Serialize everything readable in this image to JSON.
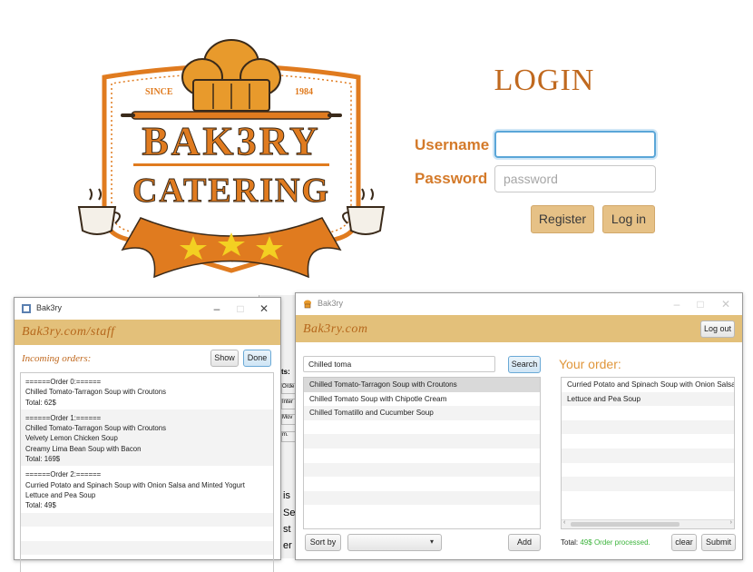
{
  "logo": {
    "since": "SINCE",
    "year": "1984",
    "word1": "BAK3RY",
    "word2": "CATERING",
    "colors": {
      "orange": "#e07b1f",
      "gold": "#f0c020",
      "dark": "#3a2a1a"
    }
  },
  "login": {
    "title": "LOGIN",
    "username_label": "Username",
    "username_value": "",
    "password_label": "Password",
    "password_placeholder": "password",
    "register_label": "Register",
    "login_label": "Log in"
  },
  "staff_window": {
    "title": "Bak3ry",
    "brand": "Bak3ry.com/staff",
    "incoming_label": "Incoming orders:",
    "show_label": "Show",
    "done_label": "Done",
    "orders": [
      {
        "header": "======Order 0:======",
        "items": [
          "Chilled Tomato-Tarragon Soup with Croutons"
        ],
        "total": "Total: 62$"
      },
      {
        "header": "======Order 1:======",
        "items": [
          "Chilled Tomato-Tarragon Soup with Croutons",
          "Velvety Lemon Chicken Soup",
          "Creamy Lima Bean Soup with Bacon"
        ],
        "total": "Total: 169$"
      },
      {
        "header": "======Order 2:======",
        "items": [
          "Curried Potato and Spinach Soup with Onion Salsa and Minted Yogurt",
          "Lettuce and Pea Soup"
        ],
        "total": "Total: 49$"
      }
    ]
  },
  "background_window": {
    "fragments": [
      "ts:",
      "Orde",
      "Inter",
      "Mov",
      "m.",
      "is",
      "Sei",
      "st",
      "er r"
    ]
  },
  "customer_window": {
    "title": "Bak3ry",
    "brand": "Bak3ry.com",
    "logout_label": "Log out",
    "search_value": "Chilled toma",
    "search_label": "Search",
    "results": [
      "Chilled Tomato-Tarragon Soup with Croutons",
      "Chilled Tomato Soup with Chipotle Cream",
      "Chilled Tomatillo and Cucumber Soup"
    ],
    "sort_label": "Sort by",
    "add_label": "Add",
    "your_order_label": "Your order:",
    "order_items": [
      "Curried Potato and Spinach Soup with Onion Salsa and Minted Yogurt",
      "Lettuce and Pea Soup"
    ],
    "total_label": "Total:",
    "total_value": "49$",
    "status_text": "Order processed.",
    "clear_label": "clear",
    "submit_label": "Submit",
    "colors": {
      "status": "#3db43d"
    }
  }
}
